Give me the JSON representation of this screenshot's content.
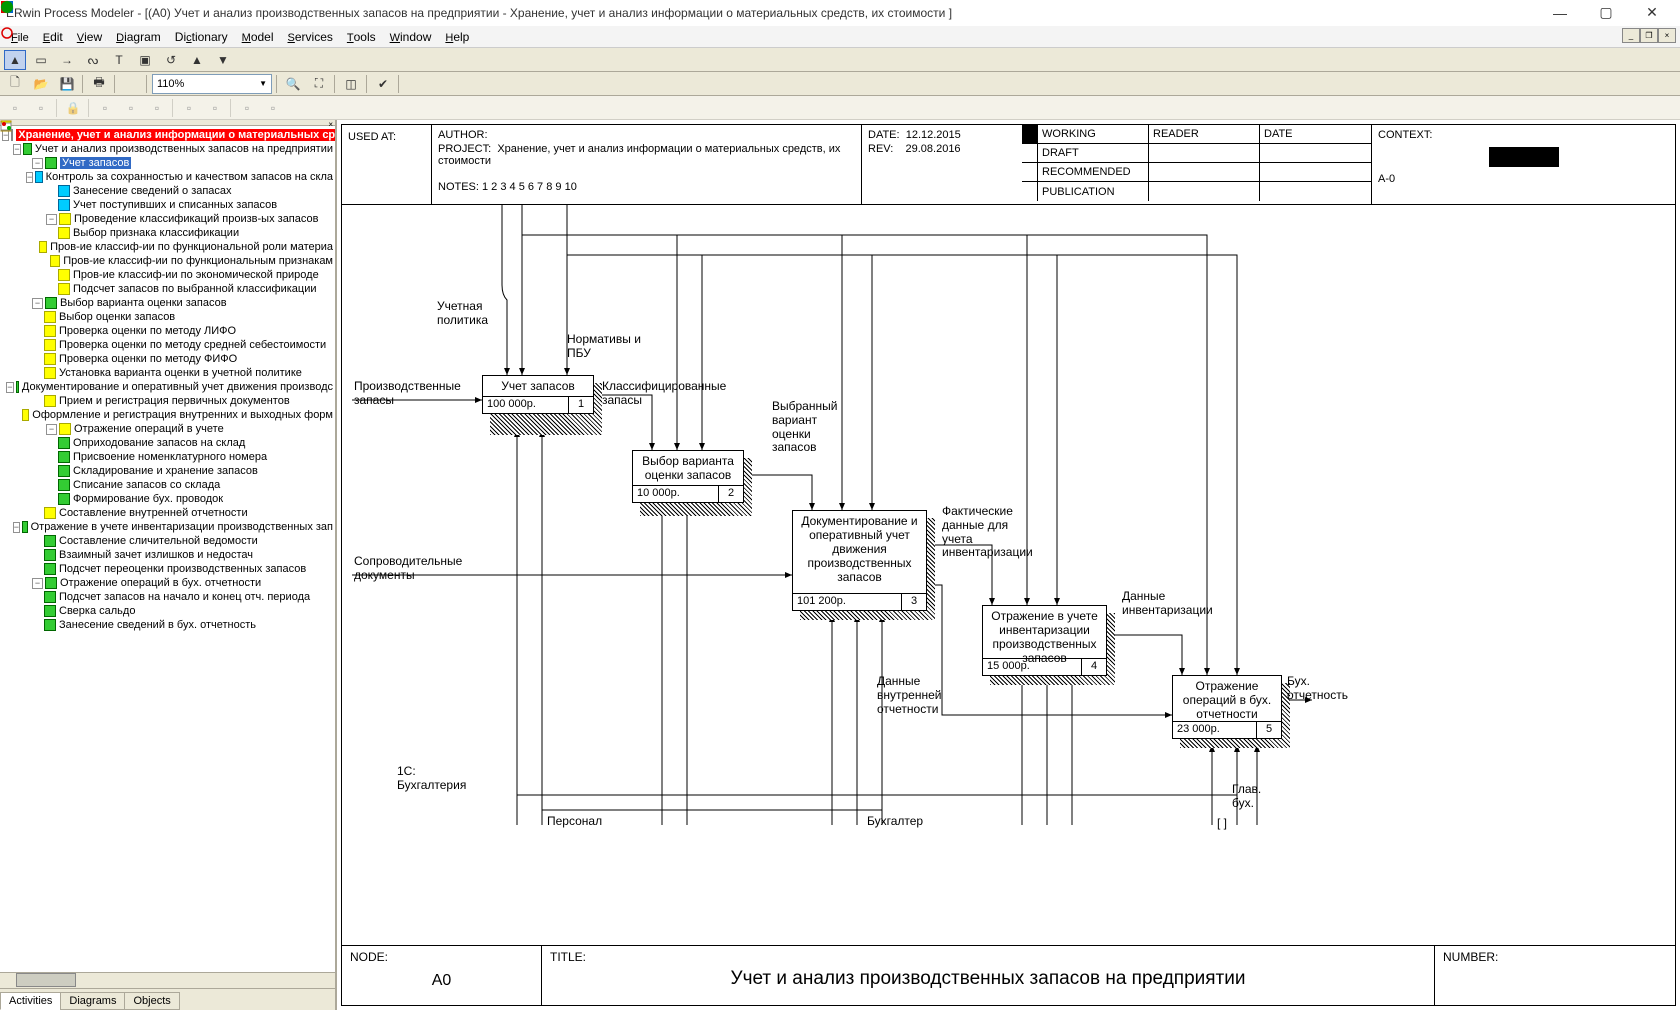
{
  "app_title": "ERwin Process Modeler - [(A0) Учет и анализ производственных запасов на предприятии - Хранение, учет и анализ информации о материальных средств, их стоимости ]",
  "menu": [
    "File",
    "Edit",
    "View",
    "Diagram",
    "Dictionary",
    "Model",
    "Services",
    "Tools",
    "Window",
    "Help"
  ],
  "zoom": "110%",
  "tree": {
    "root": "Хранение, учет и анализ информации о материальных ср",
    "n0": "Учет и анализ производственных запасов на предприятии",
    "n1": "Учет запасов",
    "n1_1": "Контроль за  сохранностью и качеством запасов на скла",
    "n1_2": "Занесение сведений  о запасах",
    "n1_3": "Учет поступивших и списанных запасов",
    "n2": "Проведение  классификаций произв-ых  запасов",
    "n2_1": "Выбор признака классификации",
    "n2_2": "Пров-ие классиф-ии по  функциональной роли материа",
    "n2_3": "Пров-ие классиф-ии по функциональным  признакам",
    "n2_4": "Пров-ие классиф-ии по  экономической природе",
    "n2_5": "Подсчет запасов по выбранной классификации",
    "n3": "Выбор варианта  оценки запасов",
    "n3_1": "Выбор оценки  запасов",
    "n3_2": "Проверка оценки  по методу ЛИФО",
    "n3_3": "Проверка оценки по методу средней себестоимости",
    "n3_4": "Проверка оценки  по методу ФИФО",
    "n3_5": "Установка варианта оценки в учетной политике",
    "n4": "Документирование  и оперативный учет  движения производс",
    "n4_1": "Прием и регистрация первичных документов",
    "n4_2": "Оформление и регистрация  внутренних и выходных форм",
    "n4_3": "Отражение операций в учете",
    "n4_3_1": "Оприходование  запасов на склад",
    "n4_3_2": "Присвоение номенклатурного номера",
    "n4_3_3": "Складирование  и хранение запасов",
    "n4_3_4": "Списание запасов  со склада",
    "n4_3_5": "Формирование бух. проводок",
    "n4_4": "Составление  внутренней  отчетности",
    "n5": "Отражение в учете  инвентаризации  производственных  зап",
    "n5_1": "Составление  сличительной  ведомости",
    "n5_2": "Взаимный зачет  излишков и  недостач",
    "n5_3": "Подсчет  переоценки  производственных   запасов",
    "n6": "Отражение  операций в  бух. отчетности",
    "n6_1": "Подсчет запасов  на начало и конец  отч. периода",
    "n6_2": "Сверка сальдо",
    "n6_3": "Занесение сведений  в бух. отчетность"
  },
  "tabs": {
    "activities": "Activities",
    "diagrams": "Diagrams",
    "objects": "Objects"
  },
  "header": {
    "used_at": "USED AT:",
    "author": "AUTHOR:",
    "project": "PROJECT:",
    "project_val": "Хранение, учет и анализ информации о материальных средств, их стоимости",
    "date": "DATE:",
    "date_val": "12.12.2015",
    "rev": "REV:",
    "rev_val": "29.08.2016",
    "notes": "NOTES:  1  2  3  4  5  6  7  8  9  10",
    "working": "WORKING",
    "draft": "DRAFT",
    "recommended": "RECOMMENDED",
    "publication": "PUBLICATION",
    "reader": "READER",
    "hdate": "DATE",
    "context": "CONTEXT:",
    "context_val": "A-0"
  },
  "footer": {
    "node": "NODE:",
    "node_val": "A0",
    "title": "TITLE:",
    "title_val": "Учет и анализ производственных запасов на предприятии",
    "number": "NUMBER:"
  },
  "boxes": {
    "b1": {
      "name": "Учет запасов",
      "cost": "100 000р.",
      "num": "1"
    },
    "b2": {
      "name": "Выбор варианта оценки запасов",
      "cost": "10 000р.",
      "num": "2"
    },
    "b3": {
      "name": "Документирование и оперативный учет движения производственных запасов",
      "cost": "101 200р.",
      "num": "3"
    },
    "b4": {
      "name": "Отражение в учете инвентаризации производственных запасов",
      "cost": "15 000р.",
      "num": "4"
    },
    "b5": {
      "name": "Отражение операций в бух. отчетности",
      "cost": "23 000р.",
      "num": "5"
    }
  },
  "labels": {
    "l1": "Учетная\nполитика",
    "l2": "Нормативы и\nПБУ",
    "l3": "Производственные\nзапасы",
    "l4": "Классифицированные\nзапасы",
    "l5": "Выбранный\nвариант\nоценки\nзапасов",
    "l6": "Сопроводительные\nдокументы",
    "l7": "Фактические\nданные для\nучета\nинвентаризации",
    "l8": "Данные\nвнутренней\nотчетности",
    "l9": "Данные\nинвентаризации",
    "l10": "Бух.\nотчетность",
    "l11": "1С:\nБухгалтерия",
    "l12": "Персонал",
    "l13": "Бухгалтер",
    "l14": "Глав.\nбух.",
    "l15": "[ ]"
  },
  "chart_data": {
    "type": "idef0",
    "node": "A0",
    "title": "Учет и анализ производственных запасов на предприятии",
    "activities": [
      {
        "id": 1,
        "name": "Учет запасов",
        "cost": "100 000р."
      },
      {
        "id": 2,
        "name": "Выбор варианта оценки запасов",
        "cost": "10 000р."
      },
      {
        "id": 3,
        "name": "Документирование и оперативный учет движения производственных запасов",
        "cost": "101 200р."
      },
      {
        "id": 4,
        "name": "Отражение в учете инвентаризации производственных запасов",
        "cost": "15 000р."
      },
      {
        "id": 5,
        "name": "Отражение операций в бух. отчетности",
        "cost": "23 000р."
      }
    ],
    "inputs": [
      "Производственные запасы",
      "Сопроводительные документы"
    ],
    "controls": [
      "Учетная политика",
      "Нормативы и ПБУ",
      "Классифицированные запасы",
      "Выбранный вариант оценки запасов",
      "Фактические данные для учета инвентаризации",
      "Данные внутренней отчетности",
      "Данные инвентаризации"
    ],
    "outputs": [
      "Бух. отчетность"
    ],
    "mechanisms": [
      "1С: Бухгалтерия",
      "Персонал",
      "Бухгалтер",
      "Глав. бух."
    ]
  }
}
